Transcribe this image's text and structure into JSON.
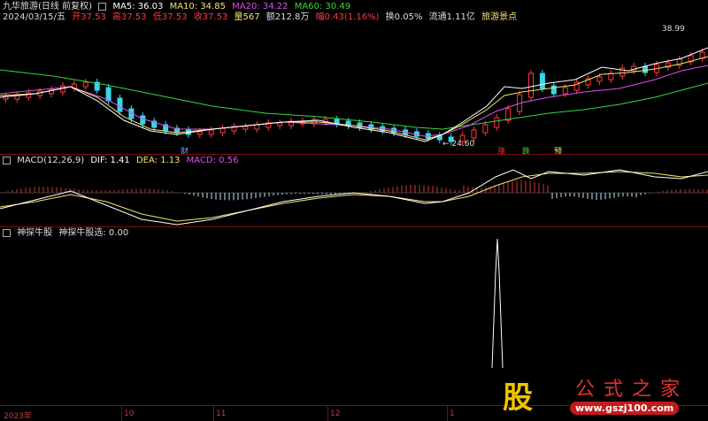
{
  "header": {
    "title": "九华旅游(日线 前复权)",
    "ma5": "MA5: 36.03",
    "ma10": "MA10: 34.85",
    "ma20": "MA20: 34.22",
    "ma60": "MA60: 30.49",
    "date": "2024/03/15/五",
    "open": "开37.53",
    "high": "高37.53",
    "low": "低37.53",
    "close": "收37.53",
    "volume": "量567",
    "amount": "额212.8万",
    "change": "幅0.43(1.16%)",
    "turnover": "换0.05%",
    "float_cap": "流通1.11亿",
    "concept": "旅游景点"
  },
  "price_pane": {
    "high_label": "38.99",
    "low_label": "24.60",
    "markers": {
      "cai": "财",
      "zhang": "涨",
      "die": "跌",
      "yu": "预"
    }
  },
  "macd_pane": {
    "name": "MACD(12,26,9)",
    "dif": "DIF: 1.41",
    "dea": "DEA: 1.13",
    "macd": "MACD: 0.56"
  },
  "indicator_pane": {
    "name": "神探牛股",
    "value": "神探牛股选: 0.00"
  },
  "x_axis": {
    "labels": [
      "2023年",
      "10",
      "11",
      "12",
      "1"
    ]
  },
  "watermark": {
    "char": "股",
    "name": "公式之家",
    "url": "www.gszj100.com"
  },
  "colors": {
    "ma5": "#ffffff",
    "ma10": "#f2e36c",
    "ma20": "#e04cf0",
    "ma60": "#38d640",
    "up": "#ff3a3a",
    "down": "#38d6e8",
    "border": "#7a0c12"
  }
}
